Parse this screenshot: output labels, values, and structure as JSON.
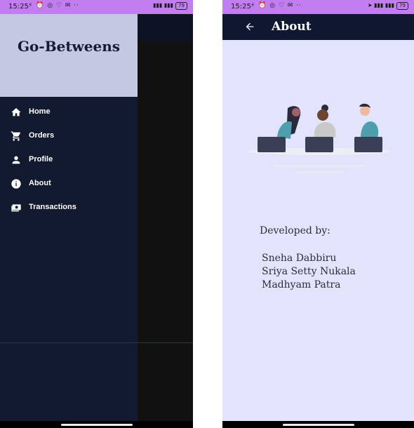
{
  "status_bar": {
    "time": "15:25",
    "battery": "79"
  },
  "drawer": {
    "title": "Go-Betweens",
    "items": [
      {
        "label": "Home",
        "icon": "home-icon"
      },
      {
        "label": "Orders",
        "icon": "cart-icon"
      },
      {
        "label": "Profile",
        "icon": "person-icon"
      },
      {
        "label": "About",
        "icon": "info-icon"
      },
      {
        "label": "Transactions",
        "icon": "money-icon"
      }
    ]
  },
  "about": {
    "title": "About",
    "developed_by": "Developed by:",
    "developers": [
      "Sneha Dabbiru",
      "Sriya Setty Nukala",
      "Madhyam Patra"
    ]
  },
  "colors": {
    "status_bar": "#c27ef0",
    "drawer_header": "#c5c8e3",
    "drawer_body": "#111a2e",
    "appbar": "#0f1830",
    "about_background": "#e2e4fc"
  }
}
